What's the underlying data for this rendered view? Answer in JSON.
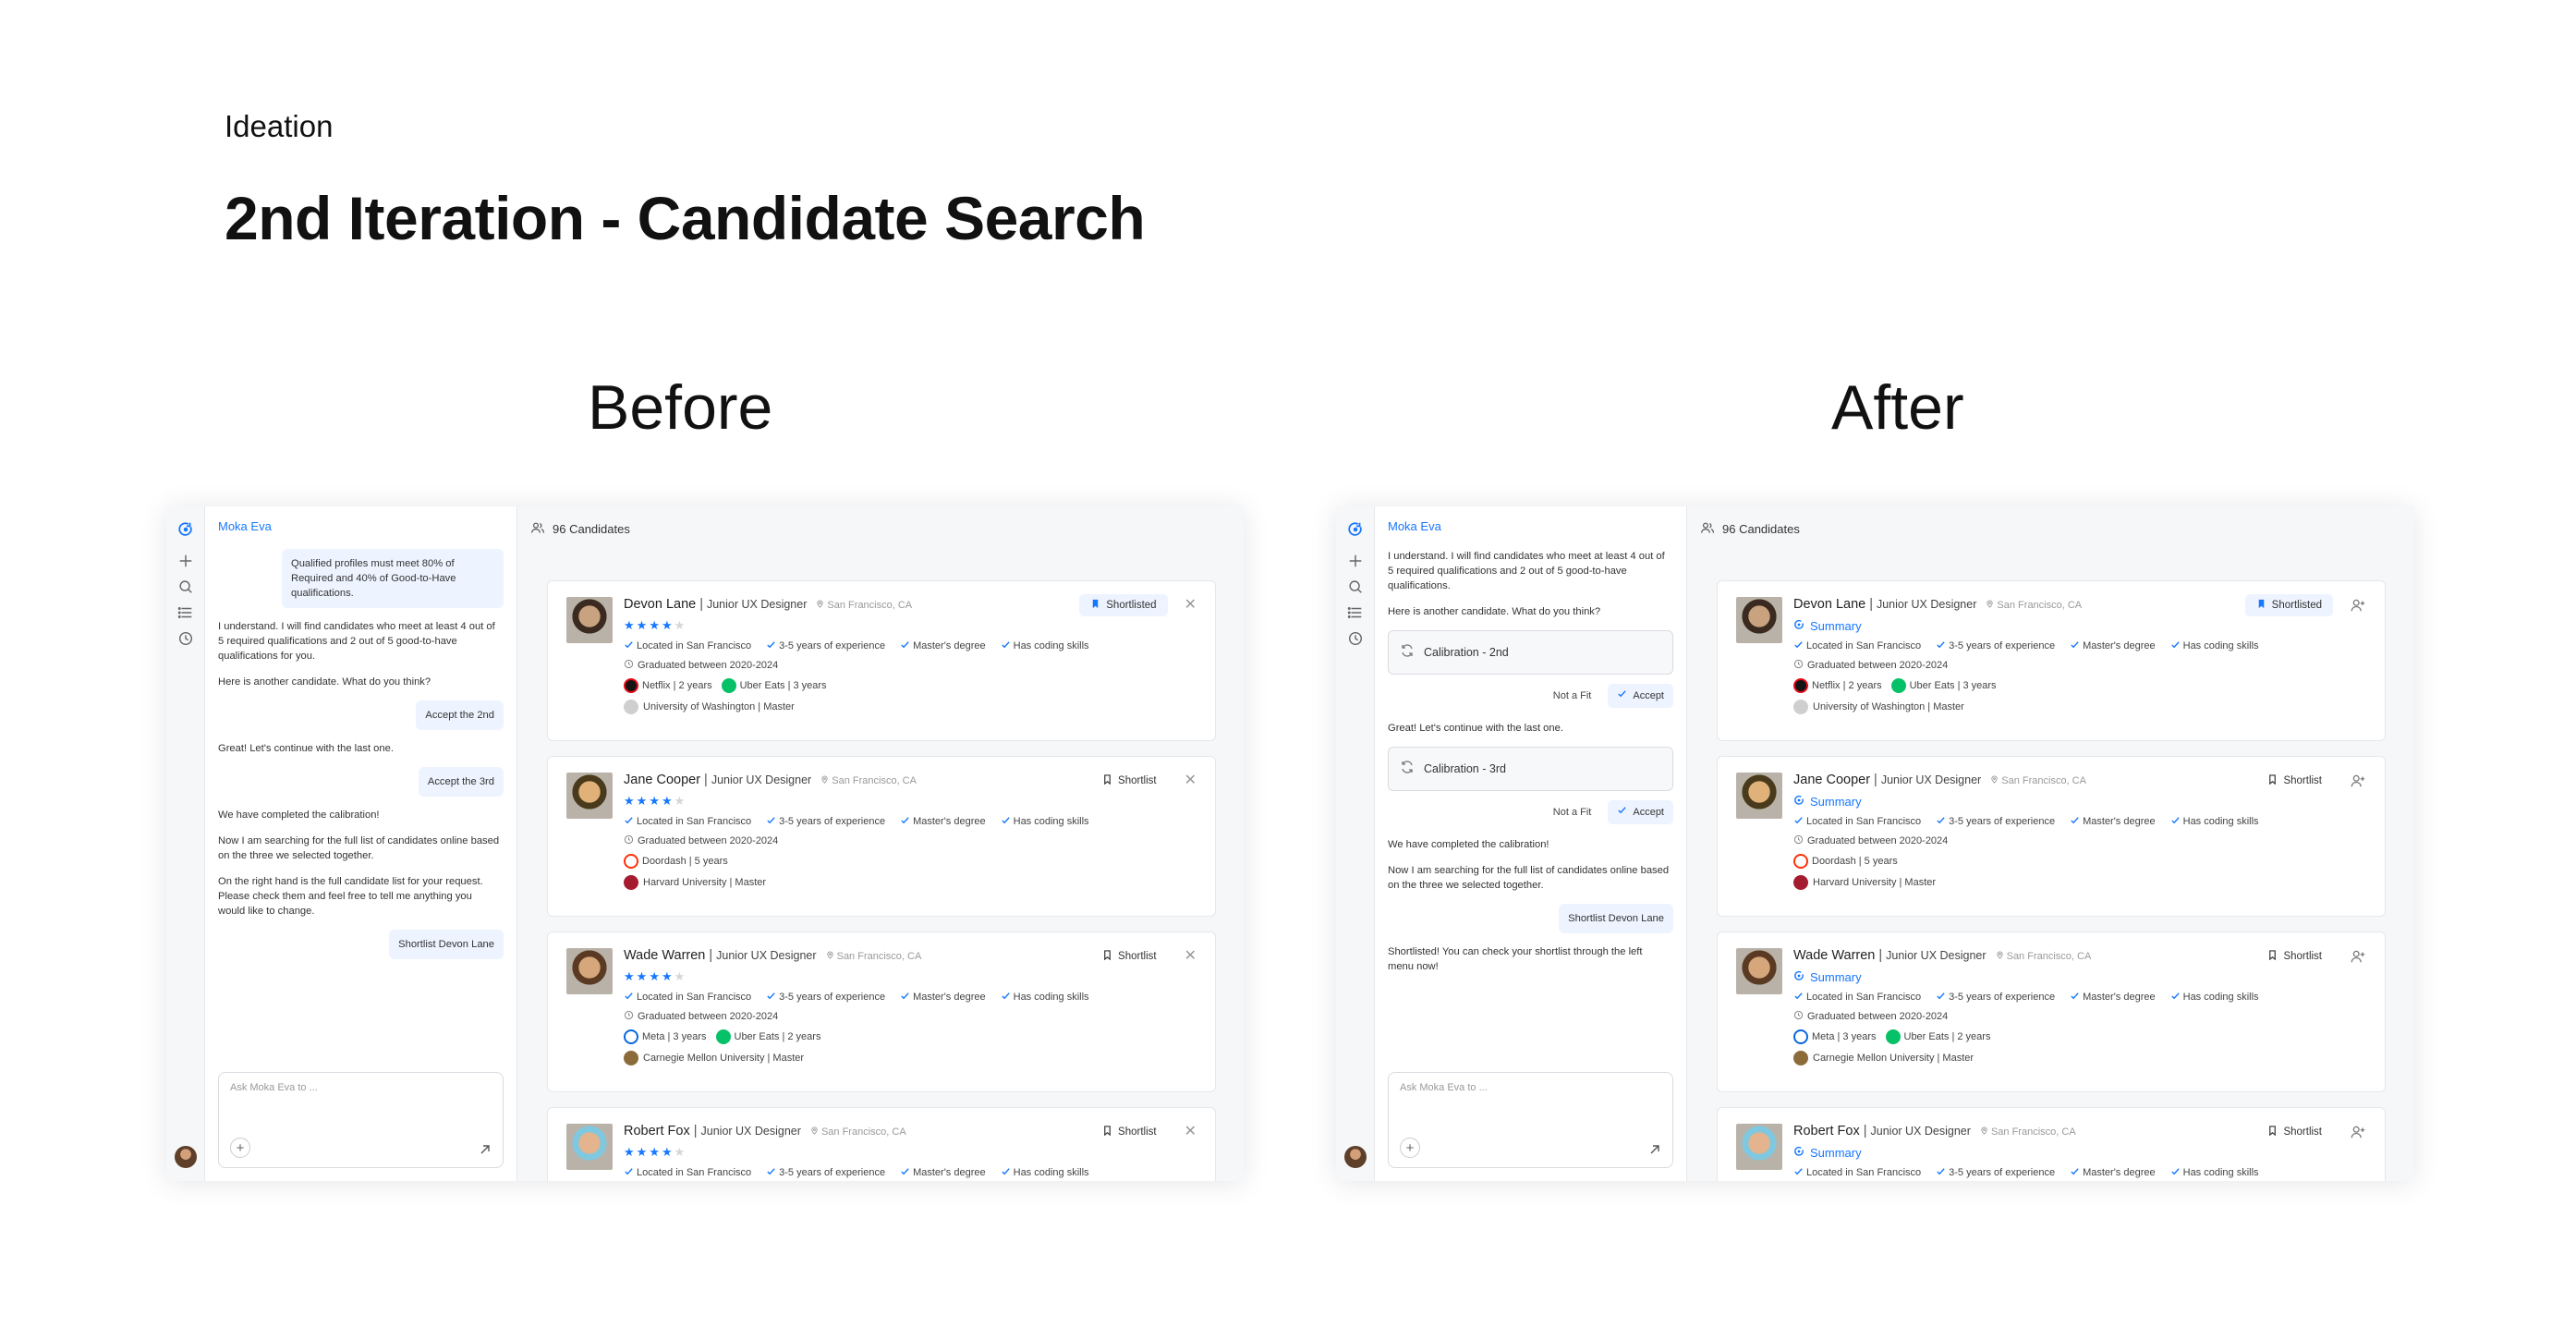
{
  "section_label": "Ideation",
  "title": "2nd Iteration - Candidate Search",
  "before_label": "Before",
  "after_label": "After",
  "common": {
    "app_name": "Moka Eva",
    "candidate_count": "96 Candidates",
    "input_placeholder": "Ask Moka Eva to ...",
    "summary_label": "Summary",
    "shortlist": "Shortlist",
    "shortlisted": "Shortlisted",
    "sep": "|"
  },
  "before_chat": [
    {
      "role": "user",
      "text": "Qualified profiles must meet 80% of Required and 40% of Good-to-Have qualifications."
    },
    {
      "role": "bot",
      "text": "I understand. I will find candidates who meet  at least 4 out of  5 required qualifications and 2 out of 5 good-to-have qualifications for you."
    },
    {
      "role": "bot",
      "text": "Here is another candidate. What do you think?"
    },
    {
      "role": "user",
      "text": "Accept the 2nd"
    },
    {
      "role": "bot",
      "text": "Great! Let's continue with the last one."
    },
    {
      "role": "user",
      "text": "Accept the 3rd"
    },
    {
      "role": "bot",
      "text": "We have completed the calibration!"
    },
    {
      "role": "bot",
      "text": "Now I am searching for the full list of candidates online based on the three we selected together."
    },
    {
      "role": "bot",
      "text": "On the right hand is the full candidate list for your request. Please check them and feel free to tell me anything you would like to change."
    },
    {
      "role": "user",
      "text": "Shortlist Devon Lane"
    }
  ],
  "after_chat": [
    {
      "role": "bot",
      "text": "I understand. I will find candidates who meet  at least 4 out of  5 required qualifications and 2 out of 5 good-to-have qualifications."
    },
    {
      "role": "bot",
      "text": "Here is another candidate. What do you think?"
    },
    {
      "role": "calib",
      "text": "Calibration - 2nd",
      "not_fit": "Not a Fit",
      "accept": "Accept"
    },
    {
      "role": "bot",
      "text": "Great! Let's continue with the last one."
    },
    {
      "role": "calib",
      "text": "Calibration - 3rd",
      "not_fit": "Not a Fit",
      "accept": "Accept"
    },
    {
      "role": "bot",
      "text": "We have completed the calibration!"
    },
    {
      "role": "bot",
      "text": "Now I am searching for the full list of candidates online based on the three we selected together."
    },
    {
      "role": "user",
      "text": "Shortlist Devon Lane"
    },
    {
      "role": "bot",
      "text": "Shortlisted! You can check your shortlist through the left menu now!"
    }
  ],
  "candidates": [
    {
      "name": "Devon Lane",
      "role": "Junior UX Designer",
      "location": "San Francisco, CA",
      "stars": 4,
      "shortlisted": true,
      "chips": [
        "Located in San Francisco",
        "3-5 years of experience",
        "Master's degree",
        "Has coding skills"
      ],
      "graduated": "Graduated between 2020-2024",
      "experience": [
        {
          "company": "Netflix | 2 years",
          "color": "#141414",
          "accent": "#e50914"
        },
        {
          "company": "Uber Eats | 3 years",
          "color": "#06c167",
          "accent": "#06c167"
        }
      ],
      "education": "University of Washington | Master",
      "edu_color": "#cfcfcf",
      "photo": [
        "#c9a37f",
        "#3a2a20"
      ]
    },
    {
      "name": "Jane Cooper",
      "role": "Junior UX Designer",
      "location": "San Francisco, CA",
      "stars": 4,
      "shortlisted": false,
      "chips": [
        "Located in San Francisco",
        "3-5 years of experience",
        "Master's degree",
        "Has coding skills"
      ],
      "graduated": "Graduated between 2020-2024",
      "experience": [
        {
          "company": "Doordash | 5 years",
          "color": "#ffffff",
          "accent": "#ff3008"
        }
      ],
      "education": "Harvard University | Master",
      "edu_color": "#a51c30",
      "photo": [
        "#e0b27a",
        "#4a3a1c"
      ]
    },
    {
      "name": "Wade Warren",
      "role": "Junior UX Designer",
      "location": "San Francisco, CA",
      "stars": 4,
      "shortlisted": false,
      "chips": [
        "Located in San Francisco",
        "3-5 years of experience",
        "Master's degree",
        "Has coding skills"
      ],
      "graduated": "Graduated between 2020-2024",
      "experience": [
        {
          "company": "Meta | 3 years",
          "color": "#ffffff",
          "accent": "#0668e1"
        },
        {
          "company": "Uber Eats | 2 years",
          "color": "#06c167",
          "accent": "#06c167"
        }
      ],
      "education": "Carnegie Mellon University | Master",
      "edu_color": "#8c6b3a",
      "photo": [
        "#d7a77c",
        "#5a3a22"
      ]
    },
    {
      "name": "Robert Fox",
      "role": "Junior UX Designer",
      "location": "San Francisco, CA",
      "stars": 4,
      "shortlisted": false,
      "chips": [
        "Located in San Francisco",
        "3-5 years of experience",
        "Master's degree",
        "Has coding skills"
      ],
      "graduated": "",
      "experience": [],
      "education": "",
      "edu_color": "#cccccc",
      "photo": [
        "#e3b48d",
        "#7fc8e0"
      ]
    }
  ],
  "colors": {
    "accent": "#1677ff",
    "bubble": "#edf4ff",
    "panel": "#f6f7f9"
  },
  "icons": [
    "moka-logo-icon",
    "plus-icon",
    "search-icon",
    "list-icon",
    "history-icon",
    "users-icon",
    "bookmark-icon",
    "close-icon",
    "add-person-icon",
    "check-icon",
    "location-pin-icon",
    "calendar-icon",
    "refresh-icon",
    "send-icon"
  ]
}
